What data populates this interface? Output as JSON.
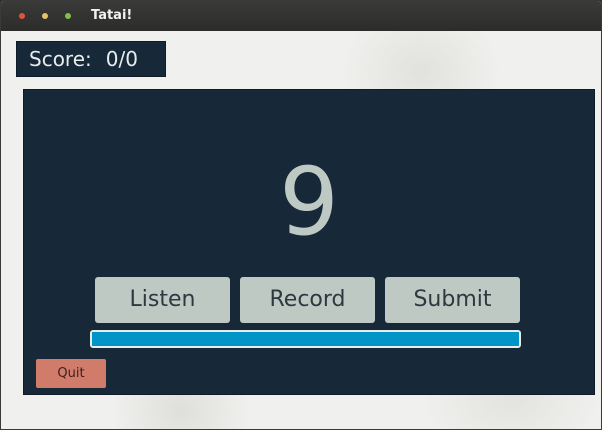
{
  "window": {
    "title": "Tatai!"
  },
  "score": {
    "label": "Score:",
    "value": "0/0"
  },
  "question": {
    "number": "9"
  },
  "buttons": {
    "listen": "Listen",
    "record": "Record",
    "submit": "Submit",
    "quit": "Quit"
  },
  "progress": {
    "fraction": 1.0
  },
  "colors": {
    "panel": "#172838",
    "button": "#bec9c4",
    "progress_fill": "#0095c6",
    "quit_button": "#d17c6a",
    "background": "#f0f0ee"
  }
}
